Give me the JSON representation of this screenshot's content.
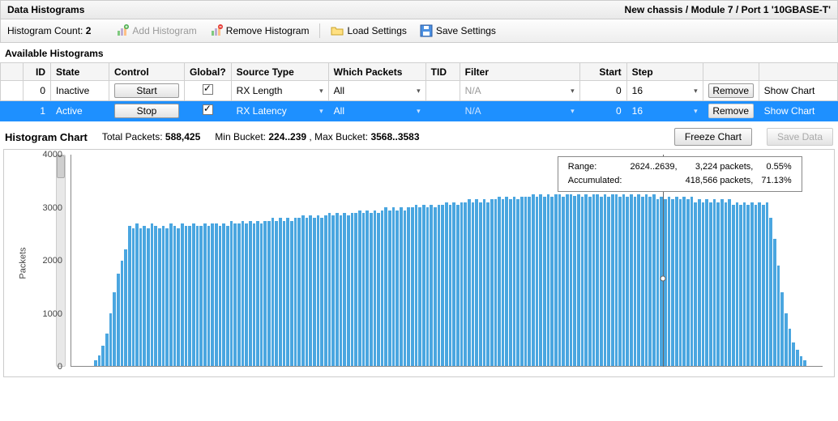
{
  "header": {
    "title": "Data Histograms",
    "breadcrumb": "New chassis / Module 7 / Port 1 '10GBASE-T'"
  },
  "toolbar": {
    "count_label": "Histogram Count:",
    "count_value": "2",
    "add": "Add Histogram",
    "remove": "Remove Histogram",
    "load": "Load Settings",
    "save": "Save Settings"
  },
  "section_label": "Available Histograms",
  "columns": {
    "id": "ID",
    "state": "State",
    "control": "Control",
    "global": "Global?",
    "source": "Source Type",
    "which": "Which Packets",
    "tid": "TID",
    "filter": "Filter",
    "start": "Start",
    "step": "Step"
  },
  "rows": [
    {
      "id": "0",
      "state": "Inactive",
      "control": "Start",
      "global": true,
      "source": "RX Length",
      "which": "All",
      "tid": "",
      "filter": "N/A",
      "start": "0",
      "step": "16",
      "remove_disabled": false,
      "show": "Show Chart",
      "selected": false
    },
    {
      "id": "1",
      "state": "Active",
      "control": "Stop",
      "global": true,
      "source": "RX Latency",
      "which": "All",
      "tid": "",
      "filter": "N/A",
      "start": "0",
      "step": "16",
      "remove_disabled": true,
      "show": "Show Chart",
      "selected": true
    }
  ],
  "row_labels": {
    "remove": "Remove"
  },
  "chart_header": {
    "title": "Histogram Chart",
    "total_label": "Total Packets:",
    "total_value": "588,425",
    "min_label": "Min Bucket:",
    "min_value": "224..239",
    "max_label": "Max Bucket:",
    "max_value": "3568..3583",
    "freeze": "Freeze Chart",
    "save": "Save Data"
  },
  "axis": {
    "ylabel": "Packets",
    "ymax_tick": "4000"
  },
  "yticks": [
    "0",
    "1000",
    "2000",
    "3000",
    "4000"
  ],
  "tooltip": {
    "range_label": "Range:",
    "range_val": "2624..2639,",
    "range_pk": "3,224 packets,",
    "range_pct": "0.55%",
    "acc_label": "Accumulated:",
    "acc_pk": "418,566 packets,",
    "acc_pct": "71.13%"
  },
  "chart_data": {
    "type": "bar",
    "title": "Histogram Chart",
    "xlabel": "",
    "ylabel": "Packets",
    "ylim": [
      0,
      4000
    ],
    "bucket_width": 16,
    "bucket_start_min": 224,
    "bucket_start_max": 3568,
    "hover_bucket_start": 2624,
    "values": [
      0,
      0,
      0,
      0,
      0,
      0,
      100,
      200,
      380,
      620,
      1000,
      1400,
      1750,
      2000,
      2200,
      2650,
      2600,
      2700,
      2600,
      2650,
      2600,
      2700,
      2650,
      2600,
      2650,
      2600,
      2700,
      2650,
      2600,
      2700,
      2650,
      2650,
      2700,
      2650,
      2650,
      2700,
      2650,
      2700,
      2700,
      2650,
      2700,
      2650,
      2750,
      2700,
      2700,
      2750,
      2700,
      2750,
      2700,
      2750,
      2700,
      2750,
      2750,
      2800,
      2750,
      2800,
      2750,
      2800,
      2750,
      2800,
      2800,
      2850,
      2800,
      2850,
      2800,
      2850,
      2800,
      2850,
      2900,
      2850,
      2900,
      2850,
      2900,
      2850,
      2900,
      2900,
      2950,
      2900,
      2950,
      2900,
      2950,
      2900,
      2950,
      3000,
      2950,
      3000,
      2950,
      3000,
      2950,
      3000,
      3000,
      3050,
      3000,
      3050,
      3000,
      3050,
      3000,
      3050,
      3050,
      3100,
      3050,
      3100,
      3050,
      3100,
      3100,
      3150,
      3100,
      3150,
      3100,
      3150,
      3100,
      3150,
      3150,
      3200,
      3150,
      3200,
      3150,
      3200,
      3150,
      3200,
      3200,
      3200,
      3250,
      3200,
      3250,
      3200,
      3250,
      3200,
      3250,
      3250,
      3200,
      3250,
      3250,
      3224,
      3250,
      3200,
      3250,
      3200,
      3250,
      3250,
      3200,
      3250,
      3200,
      3250,
      3250,
      3200,
      3250,
      3200,
      3250,
      3200,
      3250,
      3200,
      3250,
      3200,
      3250,
      3150,
      3200,
      3150,
      3200,
      3150,
      3200,
      3150,
      3200,
      3150,
      3200,
      3100,
      3150,
      3100,
      3150,
      3100,
      3150,
      3100,
      3150,
      3100,
      3150,
      3050,
      3100,
      3050,
      3100,
      3050,
      3100,
      3050,
      3100,
      3050,
      3100,
      2800,
      2400,
      1900,
      1400,
      1000,
      700,
      450,
      300,
      180,
      100,
      0,
      0,
      0,
      0
    ]
  }
}
